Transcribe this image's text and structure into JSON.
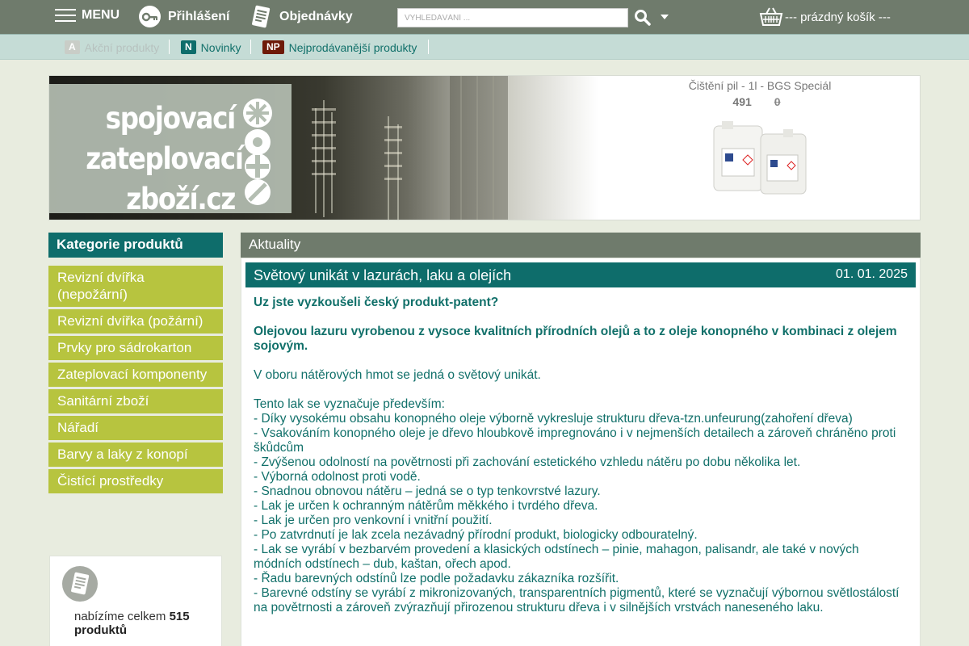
{
  "topbar": {
    "menu_label": "MENU",
    "login_label": "Přihlášení",
    "orders_label": "Objednávky",
    "search_placeholder": "VYHLEDÁVÁNÍ ...",
    "cart_label": "--- prázdný košík ---"
  },
  "subnav": [
    {
      "badge": "A",
      "label": "Akční produkty",
      "badge_color": "#c9cdc7",
      "text_color": "#b7c2bf"
    },
    {
      "badge": "N",
      "label": "Novinky",
      "badge_color": "#0e6d6b",
      "text_color": "#11706a"
    },
    {
      "badge": "NP",
      "label": "Nejprodávanější produkty",
      "badge_color": "#6e1a08",
      "text_color": "#11706a"
    }
  ],
  "banner": {
    "logo_lines": [
      "spojovací",
      "zateplovací",
      "zboží.cz"
    ],
    "promo_title": "Čištění pil - 1l - BGS Speciál",
    "promo_price": "491",
    "promo_old_price": "0"
  },
  "sidebar": {
    "header": "Kategorie produktů",
    "items": [
      "Revizní dvířka (nepožární)",
      "Revizní dvířka (požární)",
      "Prvky pro sádrokarton",
      "Zateplovací komponenty",
      "Sanitární zboží",
      "Nářadí",
      "Barvy a laky z konopí",
      "Čistící prostředky"
    ],
    "info_prefix": "nabízíme celkem",
    "info_count": "515",
    "info_suffix": "produktů"
  },
  "main": {
    "header": "Aktuality",
    "article": {
      "title": "Světový unikát v lazurách, laku a olejích",
      "date": "01. 01. 2025",
      "intro1": "Uz jste vyzkoušeli český produkt-patent?",
      "intro2": "Olejovou lazuru vyrobenou z vysoce kvalitních přírodních olejů a to z oleje konopného v kombinaci z olejem sojovým.",
      "para1": "V oboru nátěrových hmot se jedná o světový unikát.",
      "list_intro": "Tento lak se vyznačuje především:",
      "bullets": [
        "- Díky vysokému obsahu konopného oleje výborně vykresluje strukturu dřeva-tzn.unfeurung(zahoření dřeva)",
        "- Vsakováním konopného oleje je dřevo hloubkově impregnováno i v nejmenších detailech a zároveň chráněno proti škůdcům",
        "- Zvýšenou odolností na povětrnosti při zachování estetického vzhledu nátěru po dobu několika let.",
        "- Výborná odolnost proti vodě.",
        "- Snadnou obnovou nátěru – jedná se o typ tenkovrstvé lazury.",
        "- Lak je určen k ochranným nátěrům měkkého i tvrdého dřeva.",
        "- Lak je určen pro venkovní i vnitřní použití.",
        "- Po zatvrdnutí je lak zcela nezávadný přírodní produkt, biologicky odbouratelný.",
        "- Lak se vyrábí v bezbarvém provedení a klasických odstínech – pinie, mahagon, palisandr, ale také v nových módních odstínech – dub, kaštan, ořech apod.",
        "- Řadu barevných odstínů lze podle požadavku zákazníka rozšířit.",
        "- Barevné odstíny se vyrábí z mikronizovaných, transparentních pigmentů, které se vyznačují výbornou světlostálostí na povětrnosti a zároveň zvýrazňují přirozenou strukturu dřeva i v silnějších vrstvách naneseného laku."
      ]
    }
  },
  "icons": {
    "menu": "hamburger-icon",
    "login": "key-icon",
    "orders": "document-icon",
    "search": "search-icon",
    "caret": "caret-down-icon",
    "cart": "basket-icon"
  },
  "colors": {
    "topbar": "#6f7b6c",
    "accent": "#0e6d6b",
    "category": "#b7c43f",
    "text": "#11706a"
  }
}
